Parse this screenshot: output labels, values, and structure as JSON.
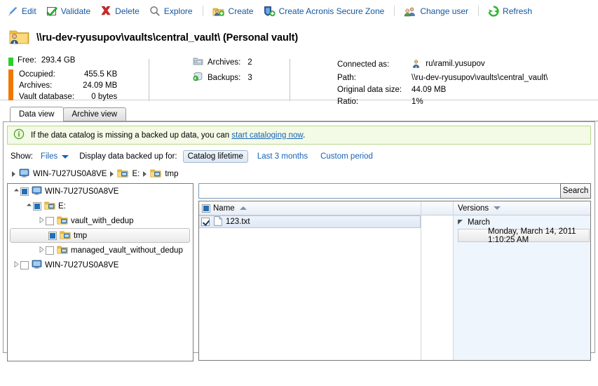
{
  "toolbar": {
    "items": [
      {
        "label": "Edit",
        "icon": "pencil-icon"
      },
      {
        "label": "Validate",
        "icon": "green-check-icon"
      },
      {
        "label": "Delete",
        "icon": "red-x-icon"
      },
      {
        "label": "Explore",
        "icon": "magnifier-icon"
      },
      {
        "label": "Create",
        "icon": "create-vault-icon"
      },
      {
        "label": "Create Acronis Secure Zone",
        "icon": "shield-plus-icon"
      },
      {
        "label": "Change user",
        "icon": "user-icon"
      },
      {
        "label": "Refresh",
        "icon": "refresh-icon"
      }
    ]
  },
  "vault": {
    "title": "\\\\ru-dev-ryusupov\\vaults\\central_vault\\ (Personal vault)",
    "icon": "personal-vault-folder-icon"
  },
  "info": {
    "free_label": "Free:",
    "free_value": "293.4 GB",
    "occupied_rows": [
      {
        "label": "Occupied:",
        "value": "455.5 KB",
        "indent": false
      },
      {
        "label": "Archives:",
        "value": "24.09 MB",
        "indent": true
      },
      {
        "label": "Vault database:",
        "value": "0 bytes",
        "indent": true
      }
    ],
    "counts": [
      {
        "label": "Archives:",
        "value": "2",
        "icon": "archive-icon"
      },
      {
        "label": "Backups:",
        "value": "3",
        "icon": "backup-icon"
      }
    ],
    "details": [
      {
        "label": "Connected as:",
        "value": "ru\\ramil.yusupov",
        "icon": "user-small-icon"
      },
      {
        "label": "Path:",
        "value": "\\\\ru-dev-ryusupov\\vaults\\central_vault\\",
        "icon": ""
      },
      {
        "label": "Original data size:",
        "value": "44.09 MB",
        "icon": ""
      },
      {
        "label": "Ratio:",
        "value": "1%",
        "icon": ""
      }
    ]
  },
  "tabs": [
    {
      "label": "Data view",
      "active": true
    },
    {
      "label": "Archive view",
      "active": false
    }
  ],
  "notice": {
    "icon": "info-icon",
    "text_before": "If the data catalog is missing a backed up data, you can ",
    "link": "start cataloging now",
    "text_after": "."
  },
  "filters": {
    "show_label": "Show:",
    "show_value": "Files",
    "display_label": "Display data backed up for:",
    "options": [
      {
        "label": "Catalog lifetime",
        "selected": true
      },
      {
        "label": "Last 3 months",
        "selected": false
      },
      {
        "label": "Custom period",
        "selected": false
      }
    ]
  },
  "breadcrumbs": [
    {
      "label": "WIN-7U27US0A8VE",
      "icon": "computer-icon"
    },
    {
      "label": "E:",
      "icon": "drive-folder-icon"
    },
    {
      "label": "tmp",
      "icon": "drive-folder-icon"
    }
  ],
  "tree": [
    {
      "label": "WIN-7U27US0A8VE",
      "icon": "computer-icon",
      "depth": 0,
      "expanded": true,
      "checkbox": "filled",
      "selected": false
    },
    {
      "label": "E:",
      "icon": "drive-folder-icon",
      "depth": 1,
      "expanded": true,
      "checkbox": "filled",
      "selected": false
    },
    {
      "label": "vault_with_dedup",
      "icon": "drive-folder-icon",
      "depth": 2,
      "expanded": false,
      "checkbox": "empty",
      "selected": false
    },
    {
      "label": "tmp",
      "icon": "drive-folder-icon",
      "depth": 3,
      "expanded": null,
      "checkbox": "filled",
      "selected": true
    },
    {
      "label": "managed_vault_without_dedup",
      "icon": "drive-folder-icon",
      "depth": 2,
      "expanded": false,
      "checkbox": "empty",
      "selected": false
    },
    {
      "label": "WIN-7U27US0A8VE",
      "icon": "computer-icon",
      "depth": 0,
      "expanded": false,
      "checkbox": "empty",
      "selected": false
    }
  ],
  "search": {
    "value": "",
    "placeholder": "",
    "button_label": "Search"
  },
  "grid": {
    "columns": [
      {
        "label": "Name",
        "sort": "asc"
      },
      {
        "label": "",
        "sort": "none"
      },
      {
        "label": "Versions",
        "sort": "desc"
      }
    ],
    "files": [
      {
        "name": "123.txt",
        "checked": true,
        "icon": "text-file-icon",
        "selected": true
      }
    ],
    "versions": [
      {
        "group": "March",
        "expanded": true,
        "items": [
          "Monday, March 14, 2011 1:10:25 AM"
        ]
      }
    ]
  },
  "colors": {
    "link": "#1763b5",
    "free_bar": "#2ad02a",
    "occupied_bar": "#f07800",
    "notice_bg": "#f3fae6",
    "notice_border": "#b9d88a",
    "versions_pane_bg": "#eef5fd"
  }
}
